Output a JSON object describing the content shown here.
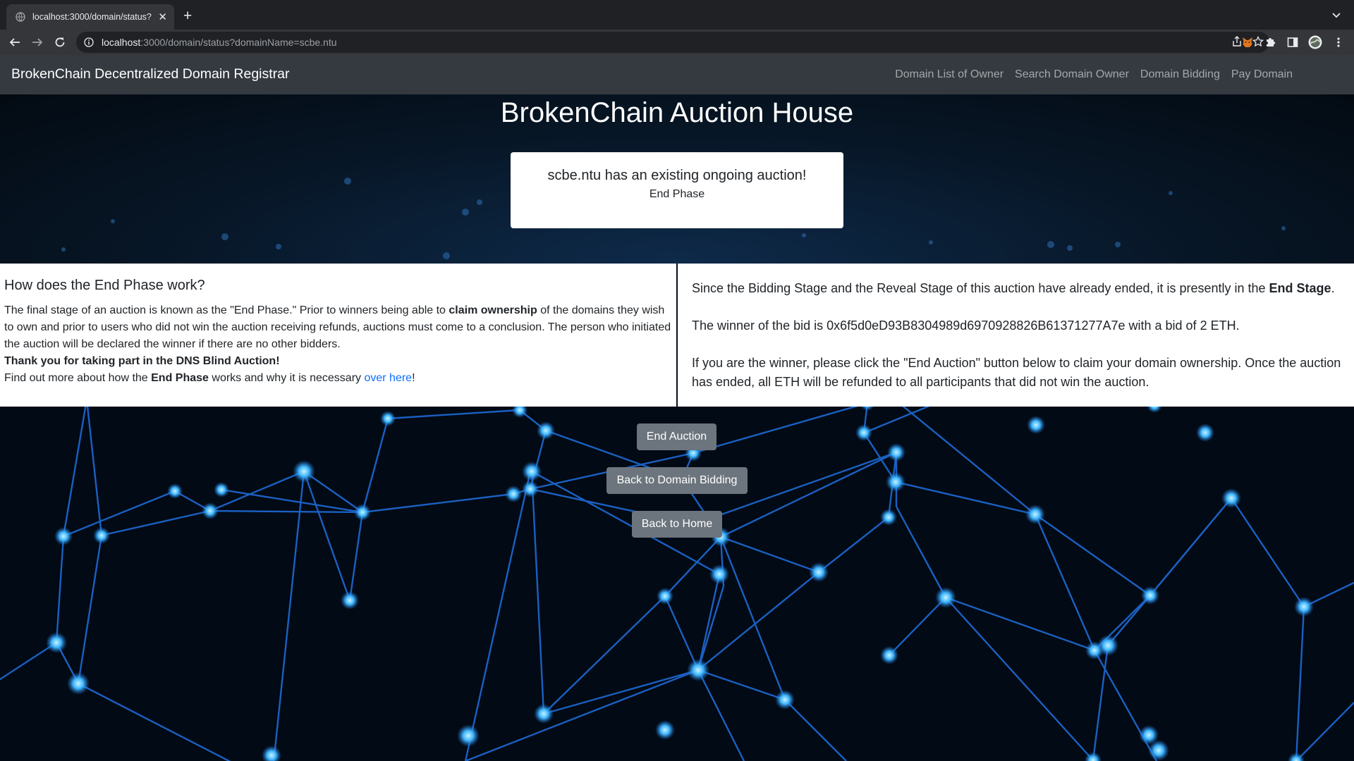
{
  "browser": {
    "tab_title": "localhost:3000/domain/status?",
    "url_host": "localhost",
    "url_rest": ":3000/domain/status?domainName=scbe.ntu"
  },
  "nav": {
    "brand": "BrokenChain Decentralized Domain Registrar",
    "links": [
      "Domain List of Owner",
      "Search Domain Owner",
      "Domain Bidding",
      "Pay Domain"
    ]
  },
  "hero": {
    "title": "BrokenChain Auction House",
    "status_message": "scbe.ntu has an existing ongoing auction!",
    "phase": "End Phase"
  },
  "left_panel": {
    "heading": "How does the End Phase work?",
    "p1_a": "The final stage of an auction is known as the \"End Phase.\" Prior to winners being able to ",
    "p1_bold": "claim ownership",
    "p1_b": " of the domains they wish to own and prior to users who did not win the auction receiving refunds, auctions must come to a conclusion. The person who initiated the auction will be declared the winner if there are no other bidders.",
    "thanks": "Thank you for taking part in the DNS Blind Auction!",
    "more_a": "Find out more about how the ",
    "more_bold": "End Phase",
    "more_b": " works and why it is necessary ",
    "more_link": "over here",
    "more_end": "!"
  },
  "right_panel": {
    "p1_a": "Since the Bidding Stage and the Reveal Stage of this auction have already ended, it is presently in the ",
    "p1_bold": "End Stage",
    "p1_end": ".",
    "p2": "The winner of the bid is 0x6f5d0eD93B8304989d6970928826B61371277A7e with a bid of 2 ETH.",
    "p3": "If you are the winner, please click the \"End Auction\" button below to claim your domain ownership. Once the auction has ended, all ETH will be refunded to all participants that did not win the auction."
  },
  "buttons": {
    "end_auction": "End Auction",
    "back_bidding": "Back to Domain Bidding",
    "back_home": "Back to Home"
  }
}
